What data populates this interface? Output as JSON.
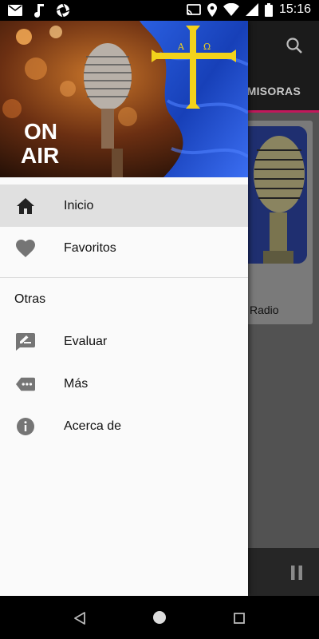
{
  "status_bar": {
    "time": "15:16",
    "left_icons": [
      "mail-icon",
      "music-note-icon",
      "camera-aperture-icon"
    ],
    "right_icons": [
      "cast-icon",
      "location-icon",
      "wifi-icon",
      "signal-icon",
      "battery-icon"
    ]
  },
  "background_app": {
    "tab_label": "EMISORAS",
    "card_label": "Radio",
    "accent_color": "#c2185b"
  },
  "drawer": {
    "header_image": {
      "caption_line1": "ON",
      "caption_line2": "AIR",
      "flag_color": "#1e50c8",
      "cross_color": "#f2d21b"
    },
    "items": [
      {
        "label": "Inicio",
        "icon": "home-icon",
        "active": true
      },
      {
        "label": "Favoritos",
        "icon": "heart-icon",
        "active": false
      }
    ],
    "section_label": "Otras",
    "other_items": [
      {
        "label": "Evaluar",
        "icon": "rate-review-icon"
      },
      {
        "label": "Más",
        "icon": "more-tag-icon"
      },
      {
        "label": "Acerca de",
        "icon": "info-icon"
      }
    ]
  },
  "nav_bar": {
    "buttons": [
      "back-icon",
      "home-circle-icon",
      "recents-icon"
    ]
  }
}
